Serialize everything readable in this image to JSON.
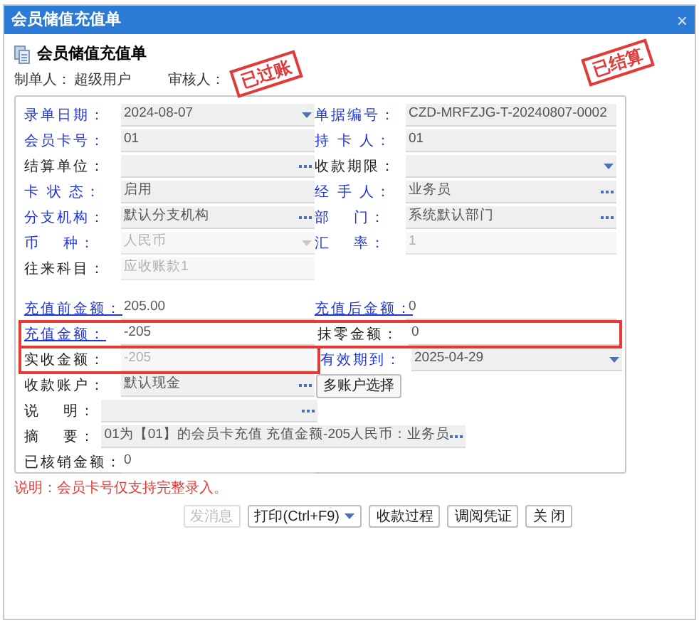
{
  "window": {
    "title": "会员储值充值单",
    "close": "×"
  },
  "header": {
    "title": "会员储值充值单",
    "maker_label": "制单人：",
    "maker": "超级用户",
    "auditor_label": "审核人："
  },
  "stamps": [
    "已过账",
    "已结算"
  ],
  "sections": [
    [
      {
        "cells": [
          {
            "label": "录单日期：",
            "value": "2024-08-07",
            "kind": "dropdown",
            "emphasized": true,
            "disabled": false,
            "marked": false
          },
          {
            "label": "单据编号：",
            "value": "CZD-MRFZJG-T-20240807-0002",
            "kind": "text",
            "emphasized": true,
            "disabled": false,
            "marked": false
          }
        ]
      },
      {
        "cells": [
          {
            "label": "会员卡号：",
            "value": "01",
            "kind": "text",
            "emphasized": true,
            "disabled": false,
            "marked": false
          },
          {
            "label": "持 卡 人：",
            "value": "01",
            "kind": "text",
            "emphasized": true,
            "disabled": false,
            "marked": false
          }
        ]
      },
      {
        "cells": [
          {
            "label": "结算单位：",
            "kind": "lookup",
            "emphasized": false,
            "disabled": false,
            "marked": false
          },
          {
            "label": "收款期限：",
            "kind": "dropdown",
            "emphasized": false,
            "disabled": false,
            "marked": false
          }
        ]
      },
      {
        "cells": [
          {
            "label": "卡 状 态：",
            "value": "启用",
            "kind": "text",
            "emphasized": true,
            "disabled": false,
            "marked": false
          },
          {
            "label": "经 手 人：",
            "value": "业务员",
            "kind": "lookup",
            "emphasized": true,
            "disabled": false,
            "marked": false
          }
        ]
      },
      {
        "cells": [
          {
            "label": "分支机构：",
            "value": "默认分支机构",
            "kind": "lookup",
            "emphasized": true,
            "disabled": false,
            "marked": false
          },
          {
            "label": "部　 门：",
            "value": "系统默认部门",
            "kind": "lookup",
            "emphasized": true,
            "disabled": false,
            "marked": false
          }
        ]
      },
      {
        "cells": [
          {
            "label": "币　 种：",
            "value": "人民币",
            "kind": "dropdown",
            "emphasized": true,
            "disabled": true,
            "marked": false
          },
          {
            "label": "汇　 率：",
            "value": "1",
            "kind": "text",
            "emphasized": true,
            "disabled": true,
            "marked": false
          }
        ]
      },
      {
        "cells": [
          {
            "label": "往来科目：",
            "value": "应收账款1",
            "kind": "text",
            "emphasized": false,
            "disabled": true,
            "marked": false
          }
        ]
      }
    ],
    [
      {
        "cells": [
          {
            "label": "充值前金额：",
            "value": "205.00",
            "kind": "plain",
            "emphasized": true,
            "disabled": false,
            "marked": false
          },
          {
            "label": "充值后金额：",
            "value": "0",
            "kind": "plain",
            "emphasized": true,
            "disabled": false,
            "marked": false
          }
        ]
      },
      {
        "cells": [
          {
            "label": "充值金额：",
            "value": "-205",
            "kind": "plain",
            "emphasized": true,
            "disabled": false,
            "marked": true
          },
          {
            "label": "抹零金额：",
            "value": "0",
            "kind": "plain",
            "emphasized": false,
            "disabled": false,
            "marked": true
          }
        ]
      },
      {
        "cells": [
          {
            "label": "实收金额：",
            "value": "-205",
            "kind": "text",
            "emphasized": false,
            "disabled": true,
            "marked": true
          },
          {
            "label": "有效期到：",
            "value": "2025-04-29",
            "kind": "dropdown",
            "emphasized": true,
            "disabled": false,
            "marked": false
          }
        ]
      },
      {
        "cells": [
          {
            "label": "收款账户：",
            "value": "默认现金",
            "kind": "lookup",
            "emphasized": false,
            "disabled": false,
            "marked": false
          },
          {
            "label": "多账户选择",
            "kind": "button",
            "emphasized": false,
            "disabled": false,
            "marked": false
          }
        ]
      },
      {
        "cells": [
          {
            "label": "说　 明：",
            "kind": "wide",
            "emphasized": false,
            "disabled": false,
            "marked": false
          }
        ]
      },
      {
        "cells": [
          {
            "label": "摘　 要：",
            "value": "01为【01】的会员卡充值 充值金额-205人民币：业务员",
            "kind": "wide",
            "emphasized": false,
            "disabled": false,
            "marked": false
          }
        ]
      },
      {
        "cells": [
          {
            "label": "已核销金额：",
            "value": "0",
            "kind": "plain",
            "emphasized": false,
            "disabled": false,
            "marked": false
          }
        ]
      }
    ]
  ],
  "note": "说明：会员卡号仅支持完整录入。",
  "buttons": [
    {
      "label": "发消息",
      "disabled": true,
      "dropdown": false
    },
    {
      "label": "打印(Ctrl+F9)",
      "disabled": false,
      "dropdown": true
    },
    {
      "label": "收款过程",
      "disabled": false,
      "dropdown": false
    },
    {
      "label": "调阅凭证",
      "disabled": false,
      "dropdown": false
    },
    {
      "label": "关 闭",
      "disabled": false,
      "dropdown": false
    }
  ]
}
